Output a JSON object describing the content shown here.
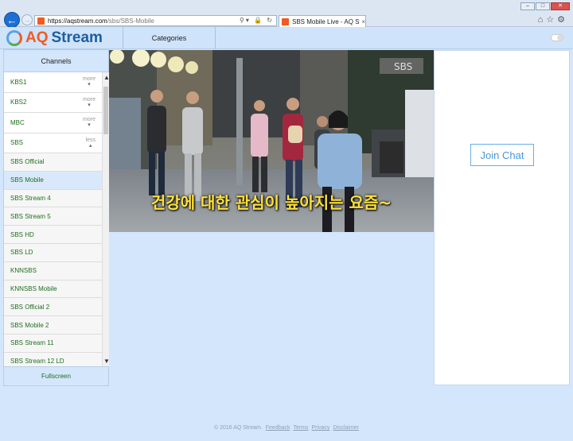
{
  "browser": {
    "url_host": "https://aqstream.com",
    "url_path": "/sbs/SBS-Mobile",
    "tab_title": "SBS Mobile Live - AQ Stre...",
    "tab_close": "×"
  },
  "header": {
    "logo_aq": "AQ",
    "logo_stream": "Stream",
    "categories_label": "Categories"
  },
  "sidebar": {
    "title": "Channels",
    "channels": [
      {
        "label": "KBS1",
        "toggle": "more"
      },
      {
        "label": "KBS2",
        "toggle": "more"
      },
      {
        "label": "MBC",
        "toggle": "more"
      },
      {
        "label": "SBS",
        "toggle": "less"
      }
    ],
    "sbs_sub": [
      "SBS Official",
      "SBS Mobile",
      "SBS Stream 4",
      "SBS Stream 5",
      "SBS HD",
      "SBS LD",
      "KNNSBS",
      "KNNSBS Mobile",
      "SBS Official 2",
      "SBS Mobile 2",
      "SBS Stream 11",
      "SBS Stream 12 LD"
    ],
    "active_index": 1,
    "fullscreen_label": "Fullscreen"
  },
  "video": {
    "subtitle": "건강에 대한 관심이 높아지는 요즘~",
    "sign": "SBS"
  },
  "chat": {
    "join_label": "Join Chat"
  },
  "footer": {
    "copyright": "© 2016 AQ Stream.",
    "links": [
      "Feedback",
      "Terms",
      "Privacy",
      "Disclaimer"
    ]
  },
  "colors": {
    "header_bg": "#cfe3fb",
    "page_bg": "#d4e6fc",
    "channel_text": "#1f6e1f",
    "logo_orange": "#f15a22",
    "logo_blue": "#1d5e9c",
    "join_chat": "#4b97d6"
  }
}
